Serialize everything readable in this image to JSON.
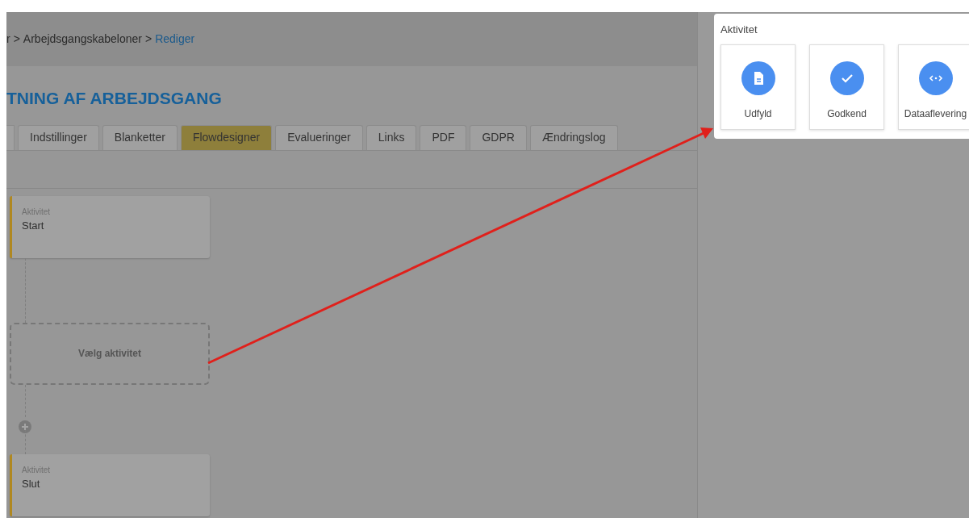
{
  "breadcrumb": [
    {
      "kind": "link",
      "text": "r"
    },
    {
      "kind": "separator",
      "text": ">"
    },
    {
      "kind": "link",
      "text": "Arbejdsgangskabeloner"
    },
    {
      "kind": "separator",
      "text": ">"
    },
    {
      "kind": "current",
      "text": "Rediger"
    }
  ],
  "page_title": "TNING AF ARBEJDSGANG",
  "tabs": [
    {
      "label": "Indstillinger",
      "selected": false
    },
    {
      "label": "Blanketter",
      "selected": false
    },
    {
      "label": "Flowdesigner",
      "selected": true
    },
    {
      "label": "Evalueringer",
      "selected": false
    },
    {
      "label": "Links",
      "selected": false
    },
    {
      "label": "PDF",
      "selected": false
    },
    {
      "label": "GDPR",
      "selected": false
    },
    {
      "label": "Ændringslog",
      "selected": false
    }
  ],
  "flow": [
    {
      "kind": "activity",
      "caption": "Aktivitet",
      "title": "Start"
    },
    {
      "kind": "placeholder",
      "title": "Vælg aktivitet"
    },
    {
      "kind": "add"
    },
    {
      "kind": "activity",
      "caption": "Aktivitet",
      "title": "Slut"
    }
  ],
  "activity_picker": {
    "title": "Aktivitet",
    "options": [
      {
        "label": "Udfyld",
        "kind": "fill"
      },
      {
        "label": "Godkend",
        "kind": "approve"
      },
      {
        "label": "Dataaflevering",
        "kind": "delivery"
      }
    ]
  }
}
